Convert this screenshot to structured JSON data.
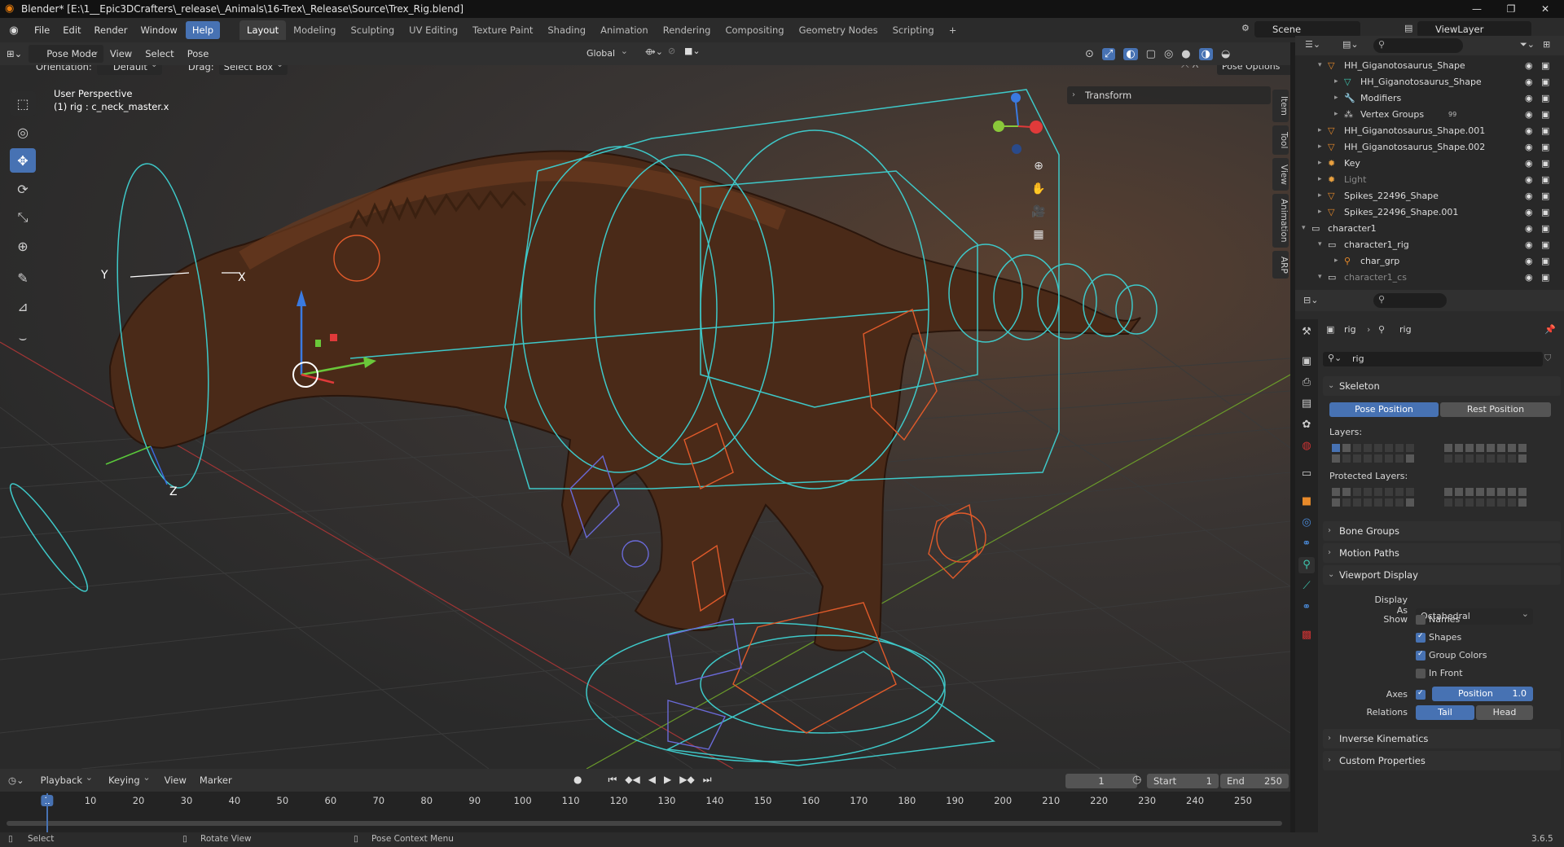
{
  "window": {
    "title": "Blender* [E:\\1__Epic3DCrafters\\_release\\_Animals\\16-Trex\\_Release\\Source\\Trex_Rig.blend]"
  },
  "menubar": {
    "items": [
      "File",
      "Edit",
      "Render",
      "Window",
      "Help"
    ]
  },
  "workspaces": [
    "Layout",
    "Modeling",
    "Sculpting",
    "UV Editing",
    "Texture Paint",
    "Shading",
    "Animation",
    "Rendering",
    "Compositing",
    "Geometry Nodes",
    "Scripting"
  ],
  "scene": {
    "name": "Scene",
    "view_layer": "ViewLayer"
  },
  "viewport_header": {
    "mode": "Pose Mode",
    "menus": [
      "View",
      "Select",
      "Pose"
    ],
    "orientation_global": "Global",
    "orientation_label": "Orientation:",
    "orientation_value": "Default",
    "drag_label": "Drag:",
    "drag_value": "Select Box",
    "pose_options": "Pose Options"
  },
  "viewport": {
    "perspective": "User Perspective",
    "active": "(1) rig : c_neck_master.x",
    "transform_panel": "Transform",
    "side_tabs": [
      "Item",
      "Tool",
      "View",
      "Animation",
      "ARP"
    ],
    "axis_labels": {
      "y": "Y",
      "x": "X",
      "z": "Z"
    }
  },
  "outliner": {
    "rows": [
      {
        "name": "HH_Giganotosaurus_Shape",
        "indent": 1,
        "icon": "mesh-icon"
      },
      {
        "name": "HH_Giganotosaurus_Shape",
        "indent": 2,
        "icon": "mesh-data-icon"
      },
      {
        "name": "Modifiers",
        "indent": 2,
        "icon": "wrench-icon"
      },
      {
        "name": "Vertex Groups",
        "indent": 2,
        "icon": "vertex-groups-icon",
        "badge": "99"
      },
      {
        "name": "HH_Giganotosaurus_Shape.001",
        "indent": 1,
        "icon": "mesh-icon"
      },
      {
        "name": "HH_Giganotosaurus_Shape.002",
        "indent": 1,
        "icon": "mesh-icon"
      },
      {
        "name": "Key",
        "indent": 1,
        "icon": "light-icon"
      },
      {
        "name": "Light",
        "indent": 1,
        "icon": "light-icon"
      },
      {
        "name": "Spikes_22496_Shape",
        "indent": 1,
        "icon": "mesh-icon"
      },
      {
        "name": "Spikes_22496_Shape.001",
        "indent": 1,
        "icon": "mesh-icon"
      },
      {
        "name": "character1",
        "indent": 0,
        "icon": "collection-icon"
      },
      {
        "name": "character1_rig",
        "indent": 1,
        "icon": "collection-icon"
      },
      {
        "name": "char_grp",
        "indent": 2,
        "icon": "empty-icon"
      },
      {
        "name": "character1_cs",
        "indent": 1,
        "icon": "collection-icon"
      }
    ]
  },
  "properties": {
    "breadcrumb_object": "rig",
    "breadcrumb_data": "rig",
    "data_name": "rig",
    "skeleton": {
      "title": "Skeleton",
      "pose_position": "Pose Position",
      "rest_position": "Rest Position",
      "layers_label": "Layers:",
      "protected_layers_label": "Protected Layers:"
    },
    "bone_groups": "Bone Groups",
    "motion_paths": "Motion Paths",
    "viewport_display": {
      "title": "Viewport Display",
      "display_as_label": "Display As",
      "display_as_value": "Octahedral",
      "show_label": "Show",
      "names": "Names",
      "shapes": "Shapes",
      "group_colors": "Group Colors",
      "in_front": "In Front",
      "axes_label": "Axes",
      "position_label": "Position",
      "position_value": "1.0",
      "relations_label": "Relations",
      "tail": "Tail",
      "head": "Head"
    },
    "inverse_kinematics": "Inverse Kinematics",
    "custom_properties": "Custom Properties"
  },
  "timeline": {
    "menus": [
      "Playback",
      "Keying",
      "View",
      "Marker"
    ],
    "current_frame": "1",
    "start_label": "Start",
    "start": "1",
    "end_label": "End",
    "end": "250",
    "frame_labels": [
      "1",
      "10",
      "20",
      "30",
      "40",
      "50",
      "60",
      "70",
      "80",
      "90",
      "100",
      "110",
      "120",
      "130",
      "140",
      "150",
      "160",
      "170",
      "180",
      "190",
      "200",
      "210",
      "220",
      "230",
      "240",
      "250"
    ]
  },
  "statusbar": {
    "select": "Select",
    "rotate": "Rotate View",
    "context": "Pose Context Menu",
    "version": "3.6.5"
  },
  "colors": {
    "accent": "#4772b3",
    "rig_cyan": "#3ec8c8",
    "rig_orange": "#e05a2a",
    "rig_purple": "#6a6ad8"
  }
}
